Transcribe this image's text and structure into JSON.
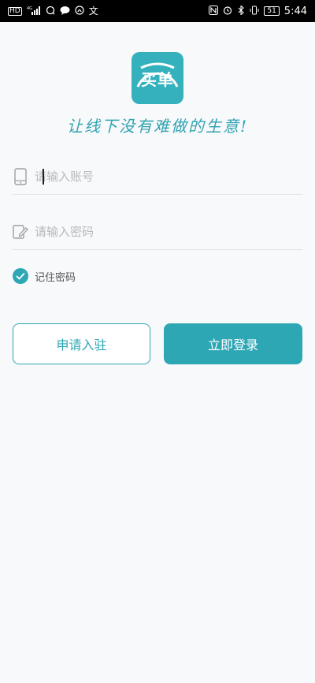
{
  "status_bar": {
    "left_icons": [
      "HD",
      "4G",
      "signal-icon",
      "chat-icon",
      "message-icon",
      "nfc-icon",
      "translate-icon"
    ],
    "battery": "51",
    "time": "5:44"
  },
  "logo": {
    "text": "买单",
    "brand_color": "#35b1be"
  },
  "slogan": "让线下没有难做的生意!",
  "form": {
    "account_placeholder": "请输入账号",
    "password_placeholder": "请输入密码",
    "remember_label": "记住密码",
    "remember_checked": true
  },
  "buttons": {
    "apply_label": "申请入驻",
    "login_label": "立即登录"
  },
  "colors": {
    "accent": "#2ea7b5",
    "background": "#f8f9fb"
  }
}
